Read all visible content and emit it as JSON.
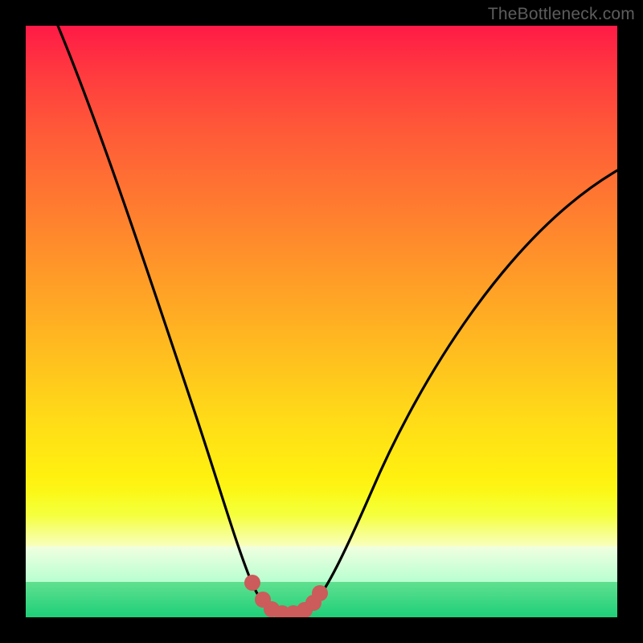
{
  "watermark": {
    "text": "TheBottleneck.com"
  },
  "colors": {
    "background": "#000000",
    "gradient_top": "#ff1a46",
    "gradient_mid": "#ffda18",
    "gradient_bottom": "#1ecf78",
    "curve_stroke": "#000000",
    "marker_fill": "#cc5b5b"
  },
  "chart_data": {
    "type": "line",
    "x": [
      0,
      5,
      10,
      15,
      20,
      25,
      30,
      33,
      36,
      38,
      40,
      42,
      44,
      46,
      48,
      52,
      58,
      66,
      74,
      82,
      90,
      100
    ],
    "series": [
      {
        "name": "bottleneck-curve",
        "values": [
          100,
          88,
          76,
          64,
          52,
          40,
          28,
          18,
          9,
          4,
          1,
          0,
          0,
          0,
          1,
          4,
          11,
          22,
          34,
          46,
          58,
          72
        ]
      }
    ],
    "markers": {
      "name": "bottleneck-floor",
      "points": [
        {
          "x": 38,
          "y": 4
        },
        {
          "x": 40,
          "y": 1
        },
        {
          "x": 42,
          "y": 0
        },
        {
          "x": 44,
          "y": 0
        },
        {
          "x": 46,
          "y": 0
        },
        {
          "x": 48,
          "y": 1
        },
        {
          "x": 49,
          "y": 3
        }
      ]
    },
    "xlabel": "",
    "ylabel": "",
    "title": "",
    "xlim": [
      0,
      100
    ],
    "ylim": [
      0,
      100
    ]
  }
}
